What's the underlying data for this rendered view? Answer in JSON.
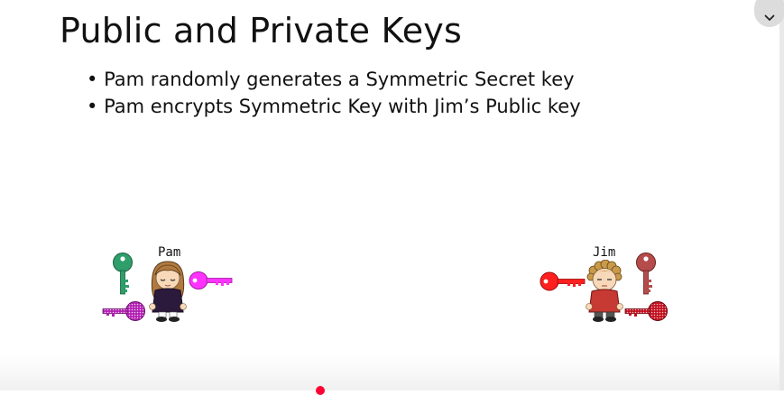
{
  "slide": {
    "title": "Public and Private Keys",
    "bullets": [
      "Pam randomly generates a Symmetric Secret key",
      "Pam encrypts Symmetric Key with Jim’s Public key"
    ]
  },
  "characters": {
    "pam": {
      "name": "Pam"
    },
    "jim": {
      "name": "Jim"
    }
  },
  "icons": {
    "collapse": "chevron-down-icon",
    "pam_keys": [
      "green-key-icon",
      "magenta-key-icon",
      "purple-key-icon"
    ],
    "jim_keys": [
      "red-key-icon",
      "dark-red-key-icon",
      "crimson-key-icon"
    ]
  },
  "colors": {
    "green_key": "#2e9e6a",
    "magenta_key": "#ff33ff",
    "purple_key": "#b01fb0",
    "red_key": "#ff1f1f",
    "dark_red_key": "#b54c4c",
    "crimson_key": "#c0101e",
    "progress": "#ff0033"
  }
}
